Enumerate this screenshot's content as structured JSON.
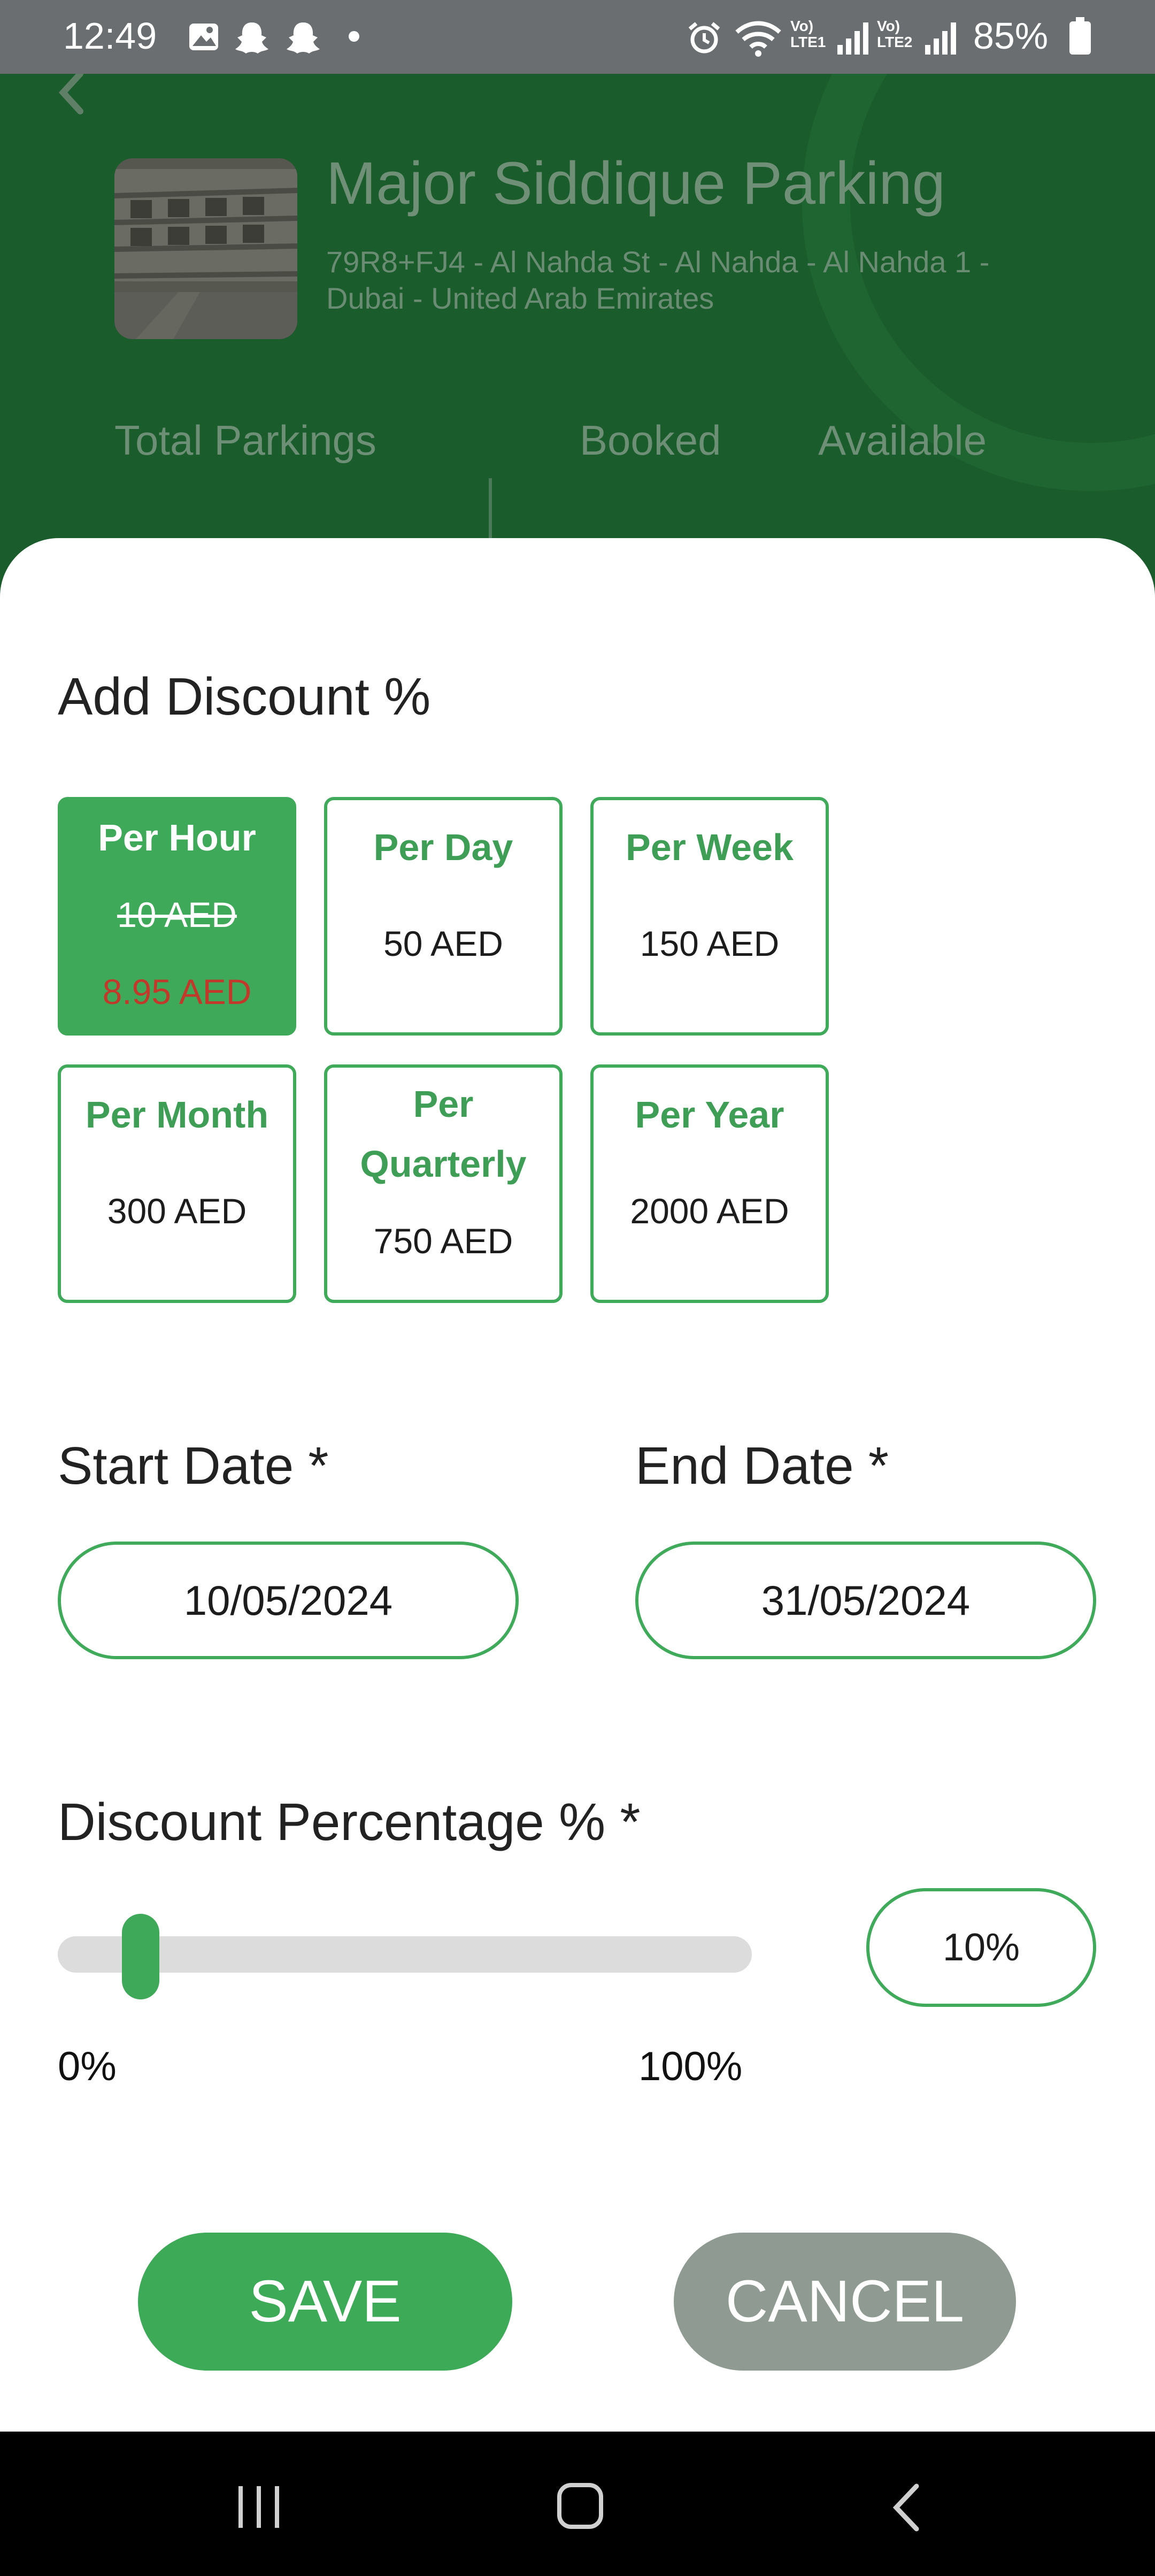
{
  "status_bar": {
    "time": "12:49",
    "battery": "85%",
    "network1": "Vo) LTE1",
    "network2": "Vo) LTE2",
    "left_icons": [
      "gallery-icon",
      "snapchat-icon",
      "snapchat-icon",
      "dot-icon"
    ],
    "right_icons": [
      "alarm-icon",
      "wifi-icon",
      "signal-icon",
      "signal-icon",
      "battery-icon"
    ]
  },
  "background": {
    "parking_name": "Major Siddique Parking",
    "address": "79R8+FJ4 - Al Nahda St - Al Nahda - Al Nahda 1 - Dubai - United Arab Emirates",
    "stats": {
      "total": "Total Parkings",
      "booked": "Booked",
      "available": "Available"
    }
  },
  "sheet": {
    "title": "Add Discount %",
    "rates": [
      {
        "title": "Per Hour",
        "price": "10 AED",
        "discounted": "8.95 AED",
        "selected": true
      },
      {
        "title": "Per Day",
        "price": "50 AED"
      },
      {
        "title": "Per Week",
        "price": "150 AED"
      },
      {
        "title": "Per Month",
        "price": "300 AED"
      },
      {
        "title_line1": "Per",
        "title_line2": "Quarterly",
        "price": "750 AED"
      },
      {
        "title": "Per Year",
        "price": "2000 AED"
      }
    ],
    "start_date": {
      "label": "Start Date *",
      "value": "10/05/2024"
    },
    "end_date": {
      "label": "End Date *",
      "value": "31/05/2024"
    },
    "discount": {
      "label": "Discount Percentage % *",
      "value": "10%",
      "fraction": 0.1,
      "min_label": "0%",
      "max_label": "100%"
    },
    "buttons": {
      "save": "SAVE",
      "cancel": "CANCEL"
    }
  },
  "colors": {
    "accent": "#3fa95a",
    "discount_red": "#c2392b",
    "cancel_gray": "#8f9b92",
    "overlay_green": "#1b5c2c"
  }
}
